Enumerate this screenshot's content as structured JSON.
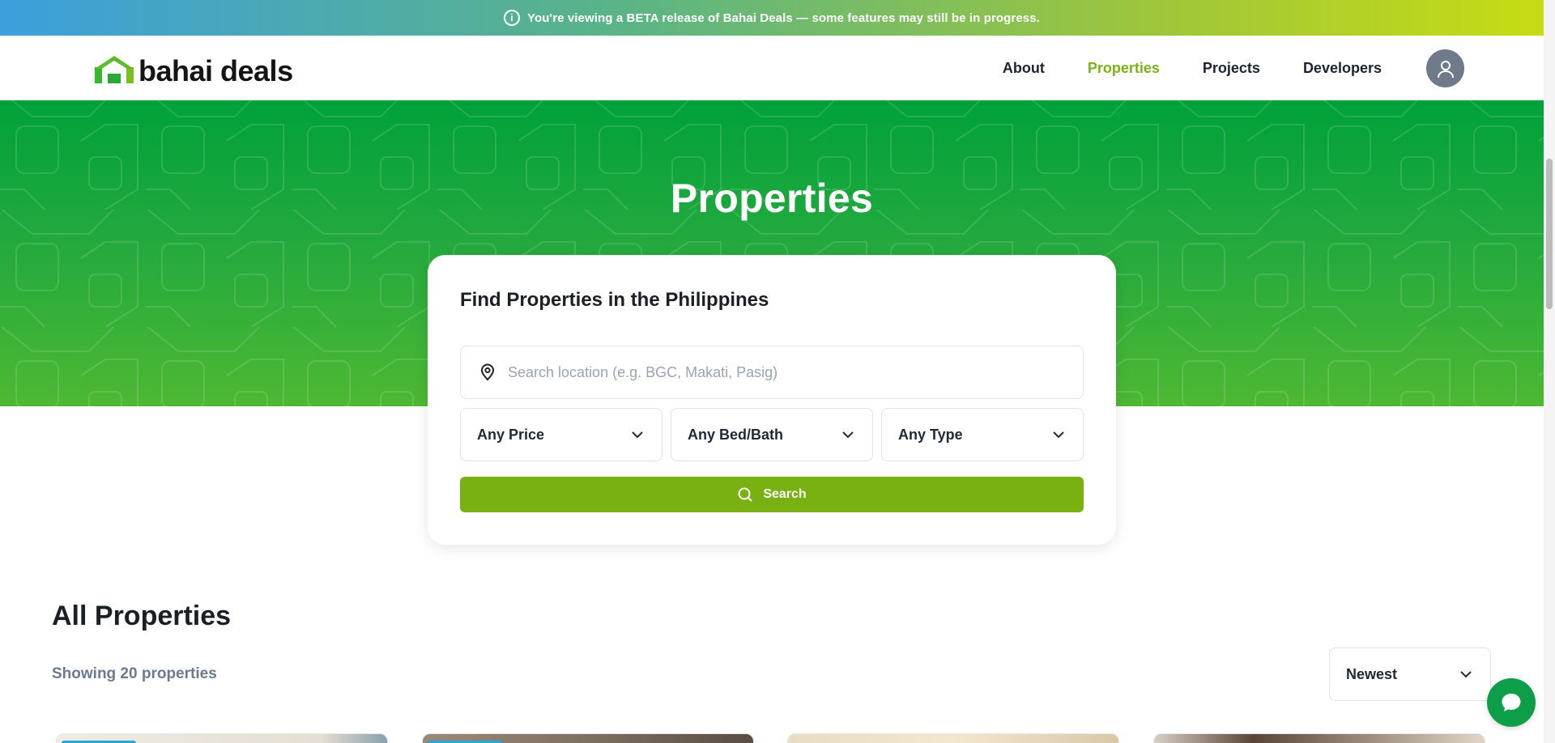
{
  "banner": {
    "text": "You're viewing a BETA release of Bahai Deals — some features may still be in progress."
  },
  "header": {
    "logo_text": "bahai deals",
    "nav": [
      {
        "label": "About",
        "active": false
      },
      {
        "label": "Properties",
        "active": true
      },
      {
        "label": "Projects",
        "active": false
      },
      {
        "label": "Developers",
        "active": false
      }
    ]
  },
  "hero": {
    "title": "Properties"
  },
  "search": {
    "title": "Find Properties in the Philippines",
    "location_placeholder": "Search location (e.g. BGC, Makati, Pasig)",
    "location_value": "",
    "price_label": "Any Price",
    "bedbath_label": "Any Bed/Bath",
    "type_label": "Any Type",
    "button_label": "Search"
  },
  "listing": {
    "title": "All Properties",
    "count_text": "Showing 20 properties",
    "sort_label": "Newest"
  },
  "colors": {
    "accent": "#7ab317",
    "hero_green": "#00a13a",
    "search_button": "#79b012",
    "chat_button": "#0e9d48"
  },
  "icons": [
    "info-icon",
    "user-avatar-icon",
    "location-pin-icon",
    "chevron-down-icon",
    "search-icon",
    "chat-bubble-icon"
  ]
}
